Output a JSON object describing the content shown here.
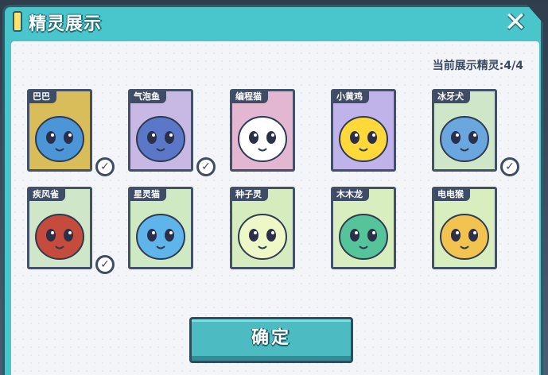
{
  "dialog": {
    "title": "精灵展示",
    "close_symbol": "✕",
    "display_count": "当前展示精灵:4/4",
    "confirm_label": "确定"
  },
  "sprites": [
    {
      "name": "巴巴",
      "selected": true,
      "card_color": "#d8bd5a",
      "body_color": "#4b96d6",
      "icon": "blue-drop-sprite"
    },
    {
      "name": "气泡鱼",
      "selected": true,
      "card_color": "#c7b9e3",
      "body_color": "#5b77c7",
      "icon": "bubble-fish-sprite"
    },
    {
      "name": "编程猫",
      "selected": false,
      "card_color": "#e3b7d2",
      "body_color": "#ffffff",
      "icon": "coding-cat-sprite"
    },
    {
      "name": "小黄鸡",
      "selected": false,
      "card_color": "#bfb3ea",
      "body_color": "#ffd83a",
      "icon": "yellow-chick-sprite"
    },
    {
      "name": "冰牙犬",
      "selected": true,
      "card_color": "#cfe6c9",
      "body_color": "#6aa7de",
      "icon": "ice-fang-dog-sprite"
    },
    {
      "name": "疾风雀",
      "selected": true,
      "card_color": "#cfe6c9",
      "body_color": "#c54b3c",
      "icon": "gale-sparrow-sprite"
    },
    {
      "name": "星灵猫",
      "selected": false,
      "card_color": "#cfe9c3",
      "body_color": "#5fb4ec",
      "icon": "star-cat-sprite"
    },
    {
      "name": "种子灵",
      "selected": false,
      "card_color": "#d6ecbe",
      "body_color": "#eef7c6",
      "icon": "seed-spirit-sprite"
    },
    {
      "name": "木木龙",
      "selected": false,
      "card_color": "#d9eebf",
      "body_color": "#56c49a",
      "icon": "wood-dragon-sprite"
    },
    {
      "name": "电电猴",
      "selected": false,
      "card_color": "#d9eebf",
      "body_color": "#f2c44f",
      "icon": "electric-monkey-sprite"
    }
  ]
}
